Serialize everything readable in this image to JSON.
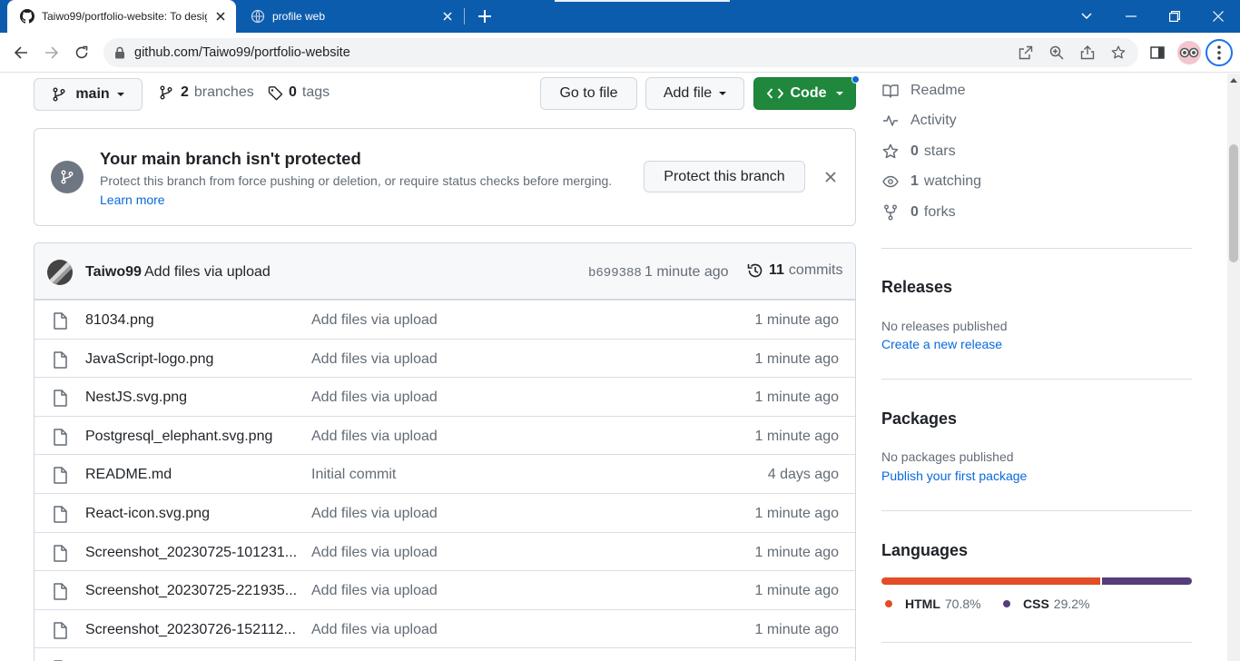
{
  "browser": {
    "tabs": [
      {
        "title": "Taiwo99/portfolio-website: To desig",
        "active": true
      },
      {
        "title": "profile web",
        "active": false
      }
    ],
    "url": "github.com/Taiwo99/portfolio-website"
  },
  "repo_nav": {
    "branch": "main",
    "branches_count": "2",
    "branches_label": "branches",
    "tags_count": "0",
    "tags_label": "tags",
    "go_to_file": "Go to file",
    "add_file": "Add file",
    "code": "Code"
  },
  "protect_banner": {
    "title": "Your main branch isn't protected",
    "description": "Protect this branch from force pushing or deletion, or require status checks before merging.",
    "learn_more": "Learn more",
    "button": "Protect this branch"
  },
  "latest_commit": {
    "author": "Taiwo99",
    "message": "Add files via upload",
    "sha": "b699388",
    "time": "1 minute ago",
    "commits_count": "11",
    "commits_label": "commits"
  },
  "files": [
    {
      "name": "81034.png",
      "message": "Add files via upload",
      "time": "1 minute ago"
    },
    {
      "name": "JavaScript-logo.png",
      "message": "Add files via upload",
      "time": "1 minute ago"
    },
    {
      "name": "NestJS.svg.png",
      "message": "Add files via upload",
      "time": "1 minute ago"
    },
    {
      "name": "Postgresql_elephant.svg.png",
      "message": "Add files via upload",
      "time": "1 minute ago"
    },
    {
      "name": "README.md",
      "message": "Initial commit",
      "time": "4 days ago"
    },
    {
      "name": "React-icon.svg.png",
      "message": "Add files via upload",
      "time": "1 minute ago"
    },
    {
      "name": "Screenshot_20230725-101231....",
      "message": "Add files via upload",
      "time": "1 minute ago"
    },
    {
      "name": "Screenshot_20230725-221935....",
      "message": "Add files via upload",
      "time": "1 minute ago"
    },
    {
      "name": "Screenshot_20230726-152112....",
      "message": "Add files via upload",
      "time": "1 minute ago"
    }
  ],
  "sidebar": {
    "readme": "Readme",
    "activity": "Activity",
    "stars_count": "0",
    "stars_label": "stars",
    "watching_count": "1",
    "watching_label": "watching",
    "forks_count": "0",
    "forks_label": "forks",
    "releases": {
      "heading": "Releases",
      "text": "No releases published",
      "link": "Create a new release"
    },
    "packages": {
      "heading": "Packages",
      "text": "No packages published",
      "link": "Publish your first package"
    },
    "languages": {
      "heading": "Languages",
      "items": [
        {
          "name": "HTML",
          "percent": "70.8%",
          "value": 70.8,
          "color": "#e34c26"
        },
        {
          "name": "CSS",
          "percent": "29.2%",
          "value": 29.2,
          "color": "#563d7c"
        }
      ]
    }
  },
  "colors": {
    "chrome_tabbar": "#0b5cad",
    "code_button": "#1f883d",
    "link": "#0969da"
  }
}
